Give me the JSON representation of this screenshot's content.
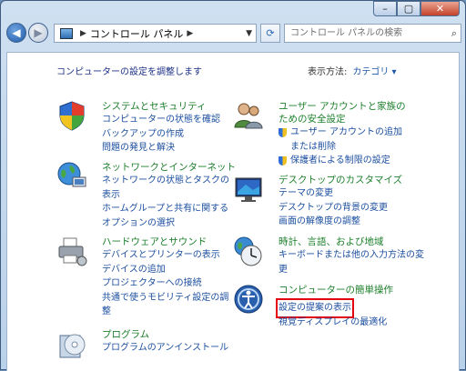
{
  "window": {
    "minimize": "0",
    "maximize": "1",
    "close": "r"
  },
  "address": {
    "breadcrumb": "コントロール パネル"
  },
  "search": {
    "placeholder": "コントロール パネルの検索"
  },
  "header": {
    "title": "コンピューターの設定を調整します",
    "view_label": "表示方法:",
    "view_value": "カテゴリ"
  },
  "left_categories": [
    {
      "title": "システムとセキュリティ",
      "links": [
        "コンピューターの状態を確認",
        "バックアップの作成",
        "問題の発見と解決"
      ]
    },
    {
      "title": "ネットワークとインターネット",
      "links": [
        "ネットワークの状態とタスクの",
        "表示",
        "ホームグループと共有に関する",
        "オプションの選択"
      ]
    },
    {
      "title": "ハードウェアとサウンド",
      "links": [
        "デバイスとプリンターの表示",
        "デバイスの追加",
        "プロジェクターへの接続",
        "共通で使うモビリティ設定の調",
        "整"
      ]
    },
    {
      "title": "プログラム",
      "links": [
        "プログラムのアンインストール"
      ]
    }
  ],
  "right_categories": [
    {
      "title": "ユーザー アカウントと家族の",
      "title2": "ための安全設定",
      "links": [
        "ユーザー アカウントの追加",
        "または削除",
        "保護者による制限の設定"
      ]
    },
    {
      "title": "デスクトップのカスタマイズ",
      "links": [
        "テーマの変更",
        "デスクトップの背景の変更",
        "画面の解像度の調整"
      ]
    },
    {
      "title": "時計、言語、および地域",
      "links": [
        "キーボードまたは他の入力方法の変",
        "更"
      ]
    },
    {
      "title": "コンピューターの簡単操作",
      "links": [
        "設定の提案の表示",
        "視覚ディスプレイの最適化"
      ]
    }
  ]
}
